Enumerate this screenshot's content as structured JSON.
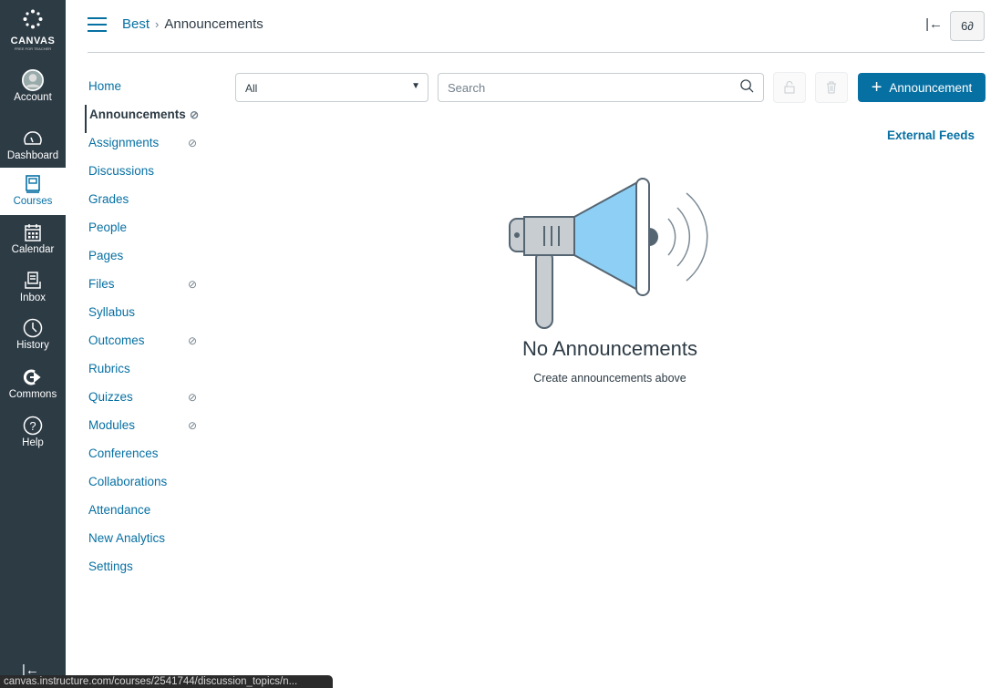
{
  "global_nav": {
    "logo_text": "CANVAS",
    "logo_sub": "FREE FOR TEACHER",
    "items": [
      {
        "label": "Account"
      },
      {
        "label": "Dashboard"
      },
      {
        "label": "Courses"
      },
      {
        "label": "Calendar"
      },
      {
        "label": "Inbox"
      },
      {
        "label": "History"
      },
      {
        "label": "Commons"
      },
      {
        "label": "Help"
      }
    ]
  },
  "header": {
    "crumb_course": "Best",
    "crumb_sep": "›",
    "crumb_page": "Announcements",
    "collapse_glyph": "|←",
    "immersive_glyph": "6∂"
  },
  "course_nav": [
    {
      "label": "Home"
    },
    {
      "label": "Announcements",
      "active": true,
      "hidden": true
    },
    {
      "label": "Assignments",
      "hidden": true
    },
    {
      "label": "Discussions"
    },
    {
      "label": "Grades"
    },
    {
      "label": "People"
    },
    {
      "label": "Pages"
    },
    {
      "label": "Files",
      "hidden": true
    },
    {
      "label": "Syllabus"
    },
    {
      "label": "Outcomes",
      "hidden": true
    },
    {
      "label": "Rubrics"
    },
    {
      "label": "Quizzes",
      "hidden": true
    },
    {
      "label": "Modules",
      "hidden": true
    },
    {
      "label": "Conferences"
    },
    {
      "label": "Collaborations"
    },
    {
      "label": "Attendance"
    },
    {
      "label": "New Analytics"
    },
    {
      "label": "Settings"
    }
  ],
  "toolbar": {
    "filter_value": "All",
    "search_placeholder": "Search",
    "add_label": "Announcement",
    "external_feeds": "External Feeds"
  },
  "empty": {
    "title": "No Announcements",
    "subtitle": "Create announcements above"
  },
  "status_url": "canvas.instructure.com/courses/2541744/discussion_topics/n...",
  "colors": {
    "nav_bg": "#2d3b45",
    "accent": "#0770a3"
  }
}
